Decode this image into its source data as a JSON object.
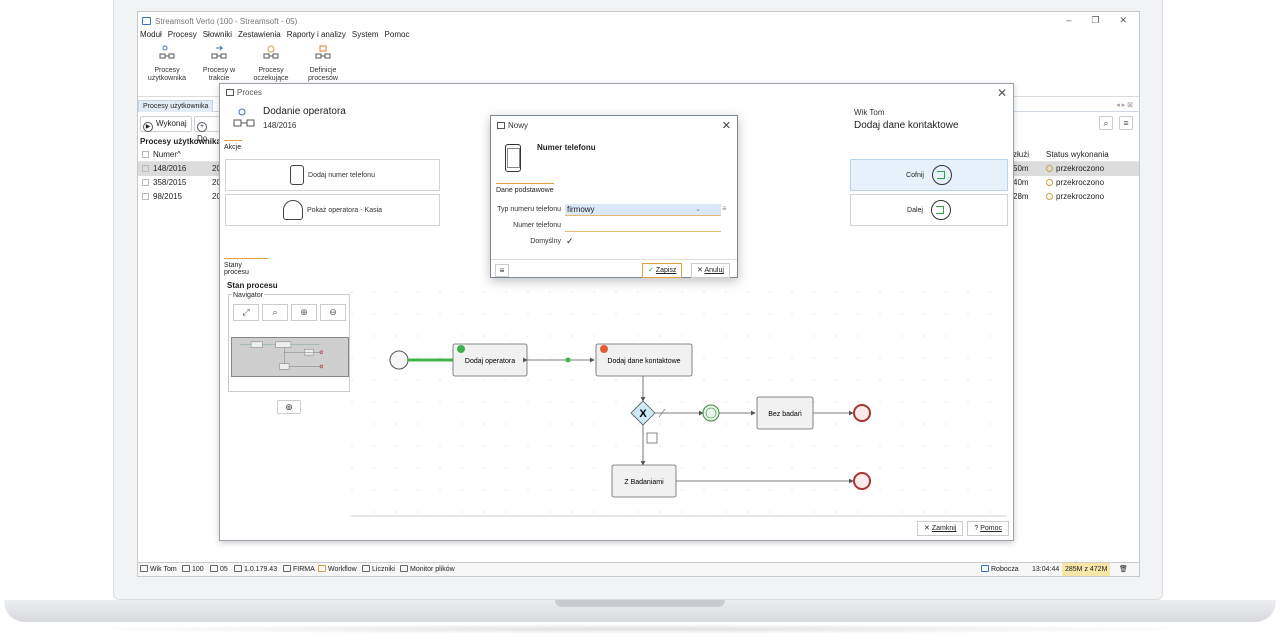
{
  "app": {
    "title": "Streamsoft Verto (100 - Streamsoft - 05)",
    "window_controls": [
      "–",
      "❐",
      "✕"
    ]
  },
  "menu": [
    "Moduł",
    "Procesy",
    "Słowniki",
    "Zestawienia",
    "Raporty i analizy",
    "System",
    "Pomoc"
  ],
  "ribbon": [
    {
      "line1": "Procesy",
      "line2": "użytkownika"
    },
    {
      "line1": "Procesy w",
      "line2": "trakcie"
    },
    {
      "line1": "Procesy",
      "line2": "oczekujące"
    },
    {
      "line1": "Definicje",
      "line2": "procesów"
    }
  ],
  "tab": {
    "label": "Procesy użytkownika",
    "nav": "◂ ▸ ⊠"
  },
  "toolbar": {
    "execute": "Wykonaj",
    "add_partial": "Do"
  },
  "list": {
    "section": "Procesy użytkownika (",
    "header_number": "Numer",
    "header_duration": "złużi",
    "header_status": "Status wykonania",
    "rows": [
      {
        "number": "148/2016",
        "col2": "20",
        "duration": "50m",
        "status": "przekroczono"
      },
      {
        "number": "358/2015",
        "col2": "20",
        "duration": "40m",
        "status": "przekroczono"
      },
      {
        "number": "98/2015",
        "col2": "20",
        "duration": "28m",
        "status": "przekroczono"
      }
    ]
  },
  "statusbar": {
    "user": "Wik Tom",
    "company_code": "100",
    "dept": "05",
    "version": "1.0.179.43",
    "firm": "FIRMA",
    "workflow": "Workflow",
    "counters": "Liczniki",
    "monitor": "Monitor plików",
    "workspace": "Robocza",
    "time": "13:04:44",
    "memory": "285M z 472M"
  },
  "proces": {
    "title": "Proces",
    "heading": "Dodanie operatora",
    "number": "148/2016",
    "actions_tab": "Akcje",
    "action1": "Dodaj numer telefonu",
    "action2": "Pokaż operatora - Kasia",
    "user": "Wik Tom",
    "task": "Dodaj dane kontaktowe",
    "back": "Cofnij",
    "next": "Dalej",
    "states_tab": "Stany procesu",
    "state_title": "Stan procesu",
    "navigator": "Navigator",
    "close": "Zamknij",
    "help": "Pomoc"
  },
  "diagram": {
    "task_add_operator": "Dodaj operatora",
    "task_add_contact": "Dodaj dane kontaktowe",
    "task_no_tests": "Bez badań",
    "task_with_tests": "Z Badaniami"
  },
  "nowy": {
    "title": "Nowy",
    "heading": "Numer telefonu",
    "tab": "Dane podstawowe",
    "type_label": "Typ numeru telefonu",
    "type_value": "firmowy",
    "number_label": "Numer telefonu",
    "number_value": "",
    "default_label": "Domyślny",
    "save": "Zapisz",
    "cancel": "Anuluj"
  }
}
